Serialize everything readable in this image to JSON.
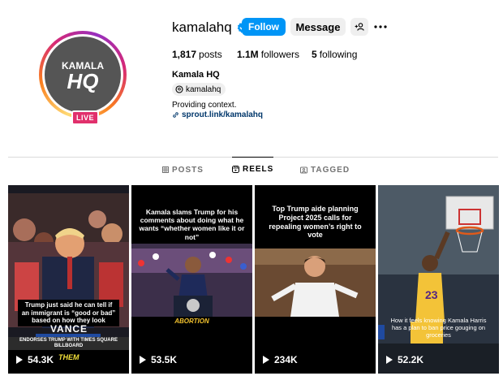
{
  "profile": {
    "username": "kamalahq",
    "follow_label": "Follow",
    "message_label": "Message",
    "avatar_text_top": "KAMALA",
    "avatar_text_bottom": "HQ",
    "live_label": "LIVE",
    "posts_count": "1,817",
    "posts_label": "posts",
    "followers_count": "1.1M",
    "followers_label": "followers",
    "following_count": "5",
    "following_label": "following",
    "full_name": "Kamala HQ",
    "threads_handle": "kamalahq",
    "bio": "Providing context.",
    "link": "sprout.link/kamalahq"
  },
  "tabs": [
    {
      "label": "POSTS",
      "icon": "grid-icon",
      "active": false
    },
    {
      "label": "REELS",
      "icon": "reels-icon",
      "active": true
    },
    {
      "label": "TAGGED",
      "icon": "tagged-icon",
      "active": false
    }
  ],
  "reels": [
    {
      "caption": "Trump just said he can tell if an immigrant is “good or bad” based on how they look",
      "sign_text": "VANCE",
      "ticker": "ENDORSES TRUMP WITH TIMES SQUARE BILLBOARD",
      "overlay_word": "THEM",
      "views": "54.3K"
    },
    {
      "caption": "Kamala slams Trump for his comments about doing what he wants “whether women like it or not”",
      "overlay_word": "ABORTION",
      "views": "53.5K"
    },
    {
      "caption": "Top Trump aide planning Project 2025 calls for repealing women’s right to vote",
      "views": "234K"
    },
    {
      "caption": "How it feels knowing Kamala Harris has a plan to ban price gouging on groceries",
      "views": "52.2K"
    }
  ],
  "colors": {
    "follow_blue": "#0095f6",
    "link_blue": "#00376b",
    "live_pink": "#e1306c",
    "verified_blue": "#0095f6"
  }
}
